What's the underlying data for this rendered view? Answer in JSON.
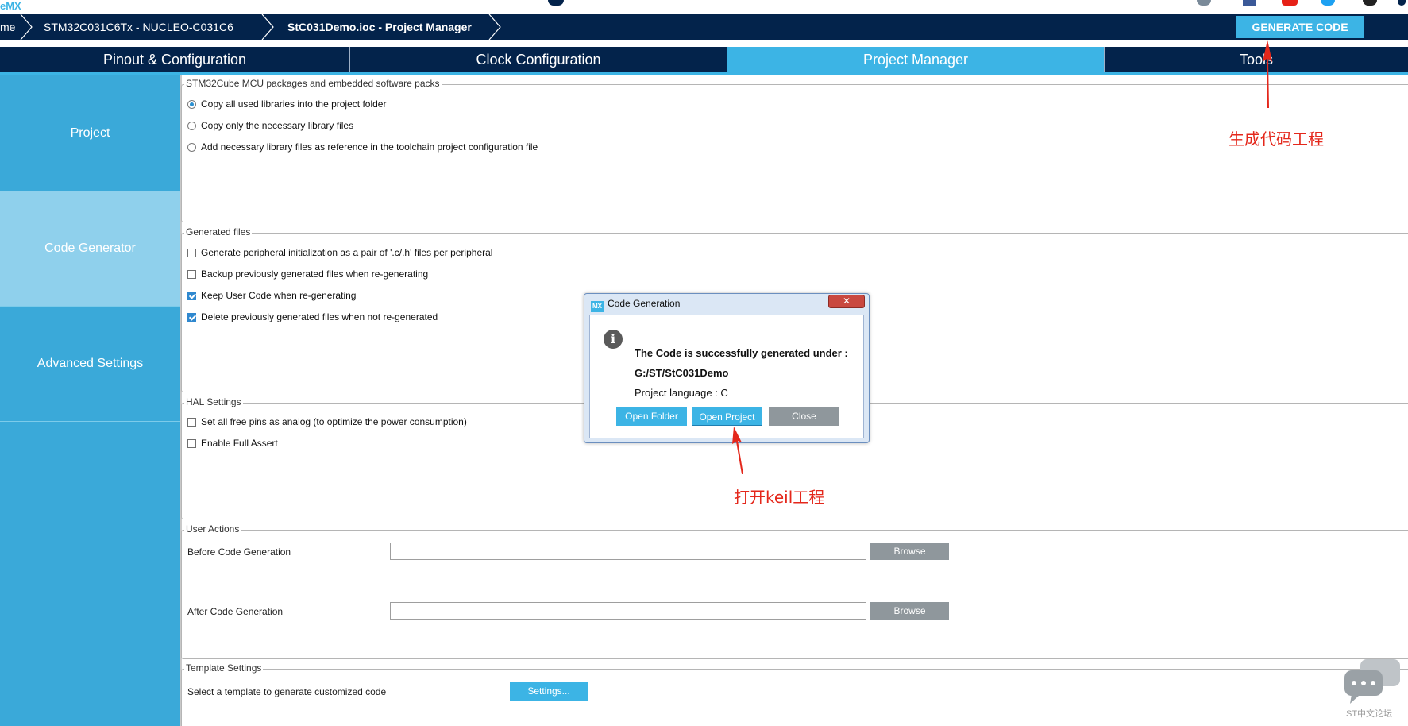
{
  "top": {
    "brand": "eMX"
  },
  "breadcrumb": {
    "items": [
      "me",
      "STM32C031C6Tx  -  NUCLEO-C031C6",
      "StC031Demo.ioc - Project Manager"
    ],
    "generate_label": "GENERATE CODE"
  },
  "tabs": [
    {
      "label": "Pinout & Configuration"
    },
    {
      "label": "Clock Configuration"
    },
    {
      "label": "Project Manager"
    },
    {
      "label": "Tools"
    }
  ],
  "sidebar": {
    "items": [
      {
        "label": "Project"
      },
      {
        "label": "Code Generator"
      },
      {
        "label": "Advanced Settings"
      }
    ]
  },
  "packages": {
    "title": "STM32Cube MCU packages and embedded software packs",
    "options": [
      {
        "label": "Copy all used libraries into the project folder",
        "selected": true
      },
      {
        "label": "Copy only the necessary library files",
        "selected": false
      },
      {
        "label": "Add necessary library files as reference in the toolchain project configuration file",
        "selected": false
      }
    ]
  },
  "generated_files": {
    "title": "Generated files",
    "options": [
      {
        "label": "Generate peripheral initialization as a pair of '.c/.h' files per peripheral",
        "checked": false
      },
      {
        "label": "Backup previously generated files when re-generating",
        "checked": false
      },
      {
        "label": "Keep User Code when re-generating",
        "checked": true
      },
      {
        "label": "Delete previously generated files when not re-generated",
        "checked": true
      }
    ]
  },
  "hal": {
    "title": "HAL Settings",
    "options": [
      {
        "label": "Set all free pins as analog (to optimize the power consumption)",
        "checked": false
      },
      {
        "label": "Enable Full Assert",
        "checked": false
      }
    ]
  },
  "user_actions": {
    "title": "User Actions",
    "before_label": "Before Code Generation",
    "before_value": "",
    "after_label": "After Code Generation",
    "after_value": "",
    "browse_label": "Browse"
  },
  "template": {
    "title": "Template Settings",
    "label": "Select a template to generate customized code",
    "button_label": "Settings..."
  },
  "dialog": {
    "logo": "MX",
    "title": "Code Generation",
    "close_glyph": "✕",
    "info_glyph": "i",
    "message": "The Code is successfully generated under :",
    "path": "G:/ST/StC031Demo",
    "language": "Project language : C",
    "open_folder_label": "Open Folder",
    "open_project_label": "Open Project",
    "close_label": "Close"
  },
  "annotations": {
    "generate": "生成代码工程",
    "open_keil": "打开keil工程"
  },
  "chat": {
    "label": "ST中文论坛"
  },
  "colors": {
    "navy": "#03234b",
    "accent": "#3cb4e5",
    "annotation": "#e4271b"
  }
}
